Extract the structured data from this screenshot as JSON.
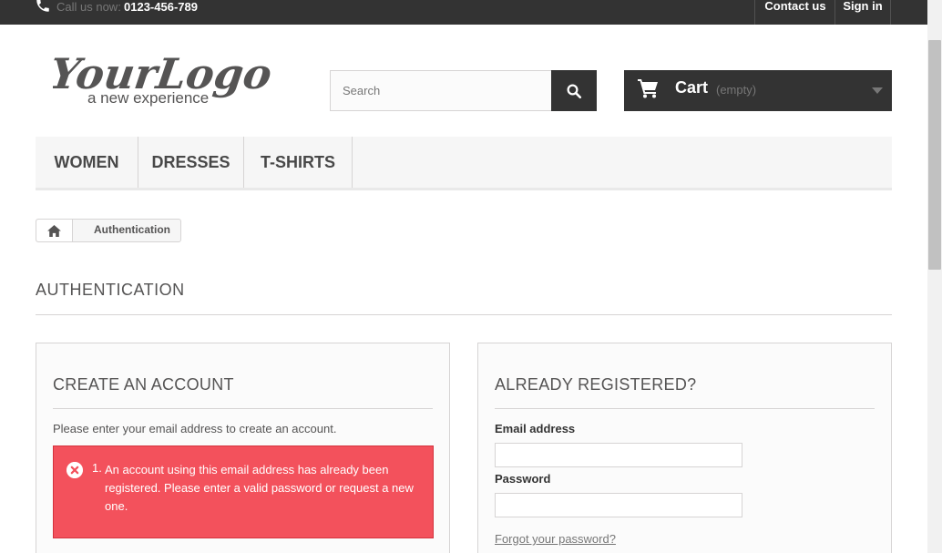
{
  "topbar": {
    "call_label": "Call us now:",
    "call_number": "0123-456-789",
    "contact_label": "Contact us",
    "signin_label": "Sign in"
  },
  "logo": {
    "line1": "YourLogo",
    "line2": "a new experience"
  },
  "search": {
    "placeholder": "Search",
    "icon": "search-icon"
  },
  "cart": {
    "label": "Cart",
    "status": "(empty)",
    "icon": "cart-icon"
  },
  "menu": {
    "items": [
      {
        "label": "WOMEN"
      },
      {
        "label": "DRESSES"
      },
      {
        "label": "T-SHIRTS"
      }
    ]
  },
  "breadcrumb": {
    "home_icon": "home-icon",
    "current": "Authentication"
  },
  "page": {
    "title": "AUTHENTICATION"
  },
  "create_account": {
    "title": "CREATE AN ACCOUNT",
    "intro": "Please enter your email address to create an account.",
    "error_number": "1.",
    "error_text": "An account using this email address has already been registered. Please enter a valid password or request a new one."
  },
  "login": {
    "title": "ALREADY REGISTERED?",
    "email_label": "Email address",
    "email_value": "",
    "password_label": "Password",
    "password_value": "",
    "forgot_label": "Forgot your password?"
  },
  "colors": {
    "dark": "#333333",
    "alert": "#f3515c",
    "border": "#d6d4d4"
  }
}
